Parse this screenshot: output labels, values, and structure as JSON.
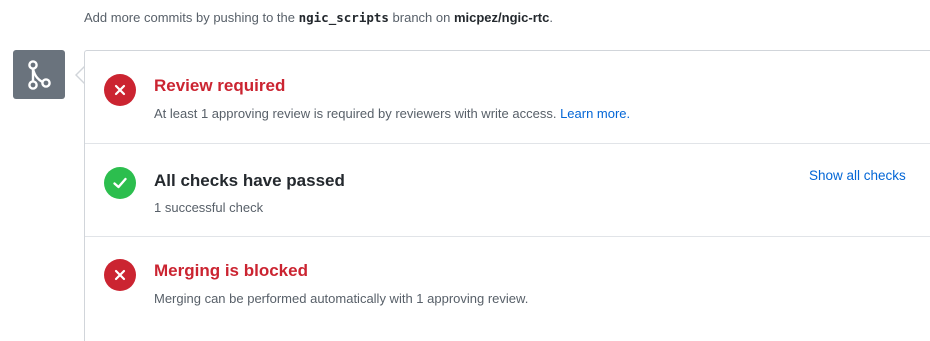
{
  "header": {
    "text_before_branch": "Add more commits by pushing to the ",
    "branch_name": "ngic_scripts",
    "text_between": " branch on ",
    "repo_name": "micpez/ngic-rtc",
    "text_after": "."
  },
  "merge_badge": {
    "icon": "git-merge-icon",
    "background": "#6a737d"
  },
  "checks": [
    {
      "status": "failure",
      "icon": "x-icon",
      "title": "Review required",
      "description": "At least 1 approving review is required by reviewers with write access. ",
      "link_text": "Learn more."
    },
    {
      "status": "success",
      "icon": "check-icon",
      "title": "All checks have passed",
      "description": "1 successful check",
      "action_label": "Show all checks"
    },
    {
      "status": "failure",
      "icon": "x-icon",
      "title": "Merging is blocked",
      "description": "Merging can be performed automatically with 1 approving review."
    }
  ],
  "colors": {
    "failure": "#cb2431",
    "success": "#2cbe4e",
    "link": "#0366d6",
    "muted_text": "#586069"
  }
}
